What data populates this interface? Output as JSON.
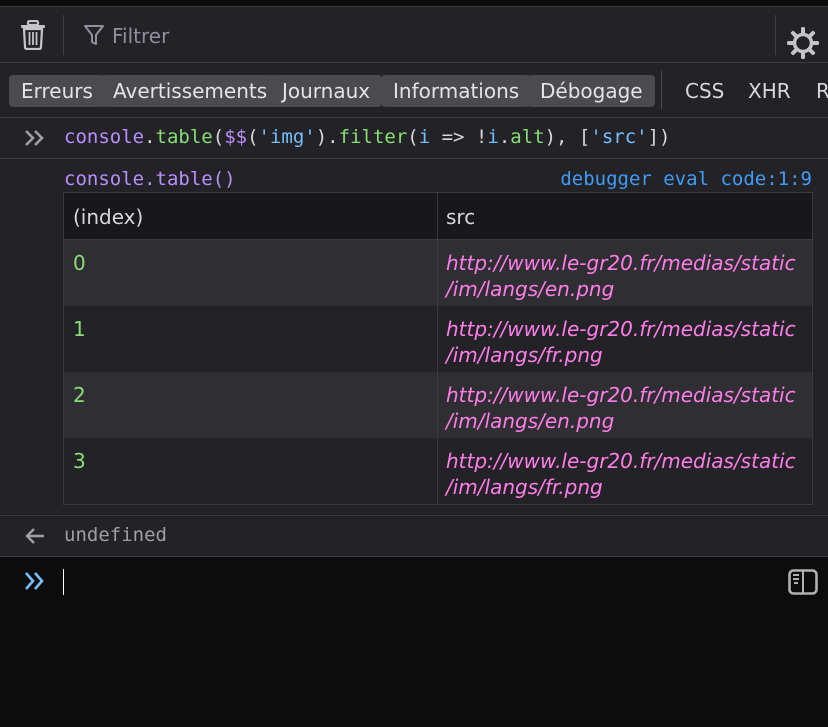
{
  "toolbar": {
    "clear_icon": "trash-icon",
    "filter_icon": "funnel-icon",
    "filter_placeholder": "Filtrer",
    "settings_icon": "gear-icon"
  },
  "filter_buttons": [
    {
      "label": "Erreurs",
      "active": true
    },
    {
      "label": "Avertissements",
      "active": true
    },
    {
      "label": "Journaux",
      "active": true
    },
    {
      "label": "Informations",
      "active": true
    },
    {
      "label": "Débogage",
      "active": true
    }
  ],
  "request_filters": [
    {
      "label": "CSS"
    },
    {
      "label": "XHR"
    },
    {
      "label": "Requêtes"
    }
  ],
  "input_command": {
    "icon": "double-chevron-right-icon",
    "tokens": [
      {
        "text": "console",
        "kind": "obj"
      },
      {
        "text": ".",
        "kind": "pun"
      },
      {
        "text": "table",
        "kind": "fn"
      },
      {
        "text": "(",
        "kind": "pun"
      },
      {
        "text": "$$",
        "kind": "obj"
      },
      {
        "text": "(",
        "kind": "pun"
      },
      {
        "text": "'img'",
        "kind": "str"
      },
      {
        "text": ").",
        "kind": "pun"
      },
      {
        "text": "filter",
        "kind": "fn"
      },
      {
        "text": "(",
        "kind": "pun"
      },
      {
        "text": "i",
        "kind": "var"
      },
      {
        "text": " => !",
        "kind": "pun"
      },
      {
        "text": "i",
        "kind": "var"
      },
      {
        "text": ".",
        "kind": "pun"
      },
      {
        "text": "alt",
        "kind": "fn"
      },
      {
        "text": "), [",
        "kind": "pun"
      },
      {
        "text": "'src'",
        "kind": "str"
      },
      {
        "text": "])",
        "kind": "pun"
      }
    ]
  },
  "output": {
    "header": "console.table()",
    "location": "debugger eval code:1:9",
    "table": {
      "columns": [
        "(index)",
        "src"
      ],
      "rows": [
        {
          "index": "0",
          "src_line1": "http://www.le-gr20.fr/medias/static",
          "src_line2": "/im/langs/en.png"
        },
        {
          "index": "1",
          "src_line1": "http://www.le-gr20.fr/medias/static",
          "src_line2": "/im/langs/fr.png"
        },
        {
          "index": "2",
          "src_line1": "http://www.le-gr20.fr/medias/static",
          "src_line2": "/im/langs/en.png"
        },
        {
          "index": "3",
          "src_line1": "http://www.le-gr20.fr/medias/static",
          "src_line2": "/im/langs/fr.png"
        }
      ]
    }
  },
  "result": {
    "icon": "arrow-left-icon",
    "value": "undefined"
  },
  "prompt": {
    "icon": "double-chevron-right-icon",
    "value": "",
    "editor_toggle_icon": "split-editor-icon"
  },
  "colors": {
    "background": "#232327",
    "prompt_background": "#0c0c0d",
    "keyword": "#b98eff",
    "function": "#86de74",
    "string": "#75bfff",
    "url": "#ff7de9",
    "link": "#3f9cf6"
  }
}
